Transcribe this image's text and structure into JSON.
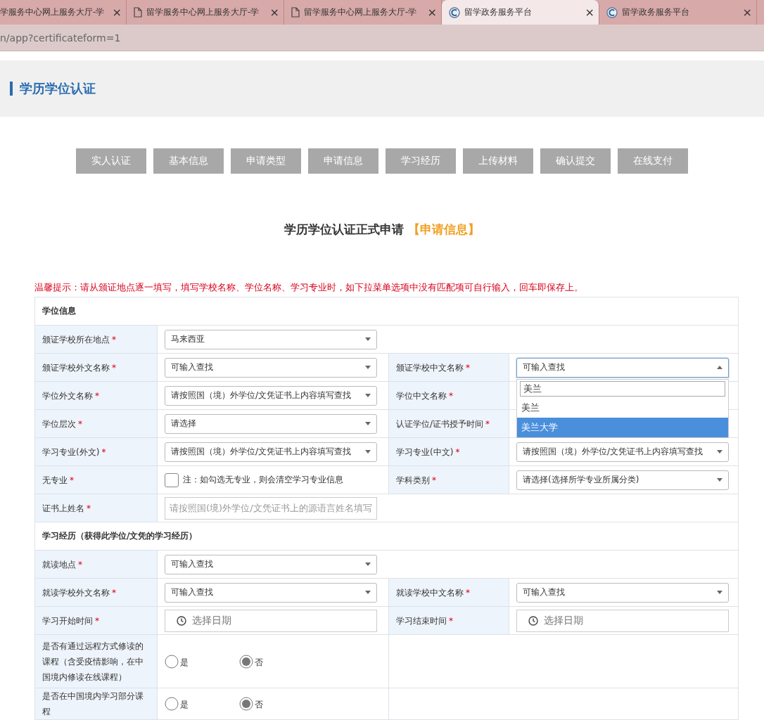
{
  "browser": {
    "tabs": [
      {
        "title": "学服务中心网上服务大厅-学",
        "close": "×",
        "selected": false
      },
      {
        "title": "留学服务中心网上服务大厅-学",
        "kind": "page",
        "close": "×",
        "selected": false
      },
      {
        "title": "留学服务中心网上服务大厅-学",
        "kind": "page",
        "close": "×",
        "selected": false
      },
      {
        "title": "留学政务服务平台",
        "kind": "site",
        "close": "×",
        "selected": true
      },
      {
        "title": "留学政务服务平台",
        "kind": "site",
        "close": "×",
        "selected": false
      }
    ],
    "address": "n/app?certificateform=1"
  },
  "page_title": "学历学位认证",
  "steps": [
    "实人认证",
    "基本信息",
    "申请类型",
    "申请信息",
    "学习经历",
    "上传材料",
    "确认提交",
    "在线支付"
  ],
  "form_title": {
    "main": "学历学位认证正式申请",
    "stage": "【申请信息】"
  },
  "notice": "温馨提示：请从颁证地点逐一填写，填写学校名称、学位名称、学习专业时，如下拉菜单选项中没有匹配项可自行输入，回车即保存上。",
  "rows": [
    {
      "kind": "section",
      "title": "学位信息"
    },
    {
      "kind": "fields",
      "fields": [
        {
          "label": "颁证学校所在地点",
          "mark": "*",
          "control": {
            "kind": "select",
            "value": "马来西亚",
            "open": false
          }
        }
      ]
    },
    {
      "kind": "fields",
      "fields": [
        {
          "label": "颁证学校外文名称",
          "mark": "*",
          "control": {
            "kind": "select",
            "value": "可输入查找",
            "open": false
          }
        },
        {
          "label": "颁证学校中文名称",
          "mark": "*",
          "control": {
            "kind": "select",
            "value": "可输入查找",
            "open": true,
            "dropdown": {
              "search": "美兰",
              "options": [
                {
                  "label": "美兰",
                  "selected": false
                },
                {
                  "label": "美兰大学",
                  "selected": true
                }
              ]
            }
          }
        }
      ]
    },
    {
      "kind": "fields",
      "fields": [
        {
          "label": "学位外文名称",
          "mark": "*",
          "control": {
            "kind": "select",
            "value": "请按照国（境）外学位/文凭证书上内容填写查找",
            "open": false
          }
        },
        {
          "label": "学位中文名称",
          "mark": "*"
        }
      ]
    },
    {
      "kind": "fields",
      "fields": [
        {
          "label": "学位层次",
          "mark": "*",
          "control": {
            "kind": "select",
            "value": "请选择",
            "open": false
          }
        },
        {
          "label": "认证学位/证书授予时间",
          "mark": "*"
        }
      ]
    },
    {
      "kind": "fields",
      "fields": [
        {
          "label": "学习专业(外文)",
          "mark": "*",
          "control": {
            "kind": "select",
            "value": "请按照国（境）外学位/文凭证书上内容填写查找",
            "open": false
          }
        },
        {
          "label": "学习专业(中文)",
          "mark": "*",
          "control": {
            "kind": "select",
            "value": "请按照国（境）外学位/文凭证书上内容填写查找",
            "open": false
          }
        }
      ]
    },
    {
      "kind": "fields",
      "fields": [
        {
          "label": "无专业",
          "mark": "*",
          "control": {
            "kind": "checkbox",
            "checked": false,
            "note": "注：如勾选无专业，则会清空学习专业信息"
          }
        },
        {
          "label": "学科类别",
          "mark": "*",
          "control": {
            "kind": "select",
            "value": "请选择(选择所学专业所属分类)",
            "open": false
          }
        }
      ]
    },
    {
      "kind": "fields",
      "fields": [
        {
          "label": "证书上姓名",
          "mark": "*",
          "control": {
            "kind": "input",
            "placeholder": "请按照国(境)外学位/文凭证书上的源语言姓名填写"
          }
        }
      ]
    },
    {
      "kind": "section",
      "title": "学习经历（获得此学位/文凭的学习经历）"
    },
    {
      "kind": "fields",
      "fields": [
        {
          "label": "就读地点",
          "mark": "*",
          "control": {
            "kind": "select",
            "value": "可输入查找",
            "open": false
          }
        }
      ]
    },
    {
      "kind": "fields",
      "fields": [
        {
          "label": "就读学校外文名称",
          "mark": "*",
          "control": {
            "kind": "select",
            "value": "可输入查找",
            "open": false
          }
        },
        {
          "label": "就读学校中文名称",
          "mark": "*",
          "control": {
            "kind": "select",
            "value": "可输入查找",
            "open": false
          }
        }
      ]
    },
    {
      "kind": "fields",
      "fields": [
        {
          "label": "学习开始时间",
          "mark": "*",
          "control": {
            "kind": "date",
            "placeholder": "选择日期"
          }
        },
        {
          "label": "学习结束时间",
          "mark": "*",
          "control": {
            "kind": "date",
            "placeholder": "选择日期"
          }
        }
      ]
    },
    {
      "kind": "fields",
      "fields": [
        {
          "label": "是否有通过远程方式修读的课程（含受疫情影响，在中国境内修读在线课程）",
          "control": {
            "kind": "radio",
            "options": [
              {
                "label": "是",
                "selected": false
              },
              {
                "label": "否",
                "selected": true
              }
            ]
          }
        }
      ]
    },
    {
      "kind": "fields",
      "fields": [
        {
          "label": "是否在中国境内学习部分课程",
          "control": {
            "kind": "radio",
            "options": [
              {
                "label": "是",
                "selected": false
              },
              {
                "label": "否",
                "selected": true
              }
            ]
          }
        }
      ]
    }
  ]
}
